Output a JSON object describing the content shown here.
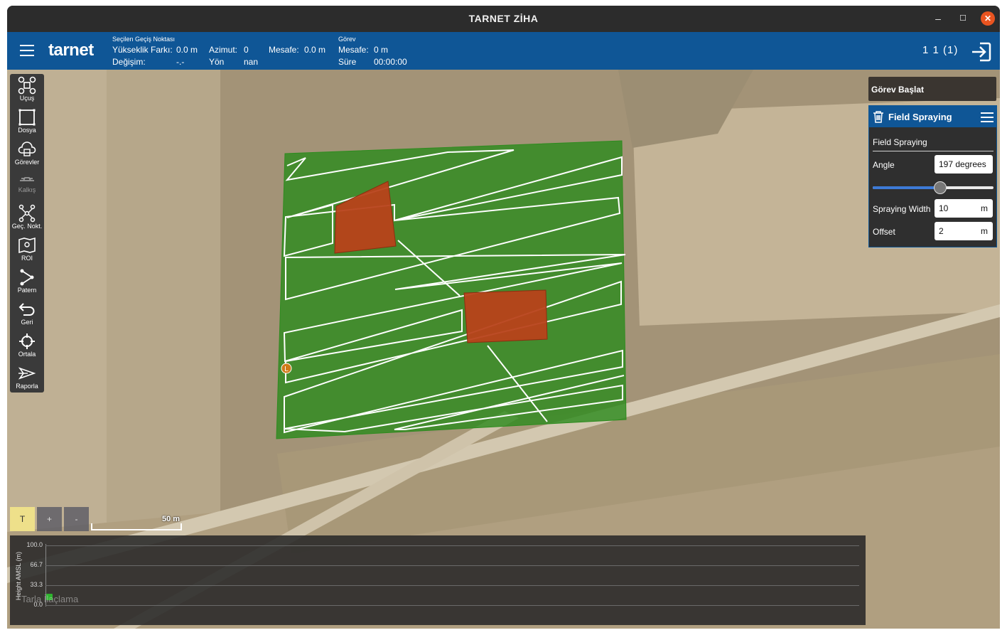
{
  "window": {
    "title": "TARNET ZİHA",
    "minimize": "–",
    "maximize": "☐",
    "close": "✕"
  },
  "topbar": {
    "logo": "tarnet",
    "selected_wp_heading": "Seçilen Geçiş Noktası",
    "alt_diff_label": "Yükseklik Farkı:",
    "alt_diff_value": "0.0 m",
    "azimuth_label": "Azimut:",
    "azimuth_value": "0",
    "distance_label": "Mesafe:",
    "distance_value": "0.0 m",
    "change_label": "Değişim:",
    "change_value": "-.-",
    "heading_label": "Yön",
    "heading_value": "nan",
    "mission_heading": "Görev",
    "mission_distance_label": "Mesafe:",
    "mission_distance_value": "0 m",
    "mission_time_label": "Süre",
    "mission_time_value": "00:00:00",
    "vehicle_status": "1 1 (1)"
  },
  "toolbar": [
    {
      "name": "flight",
      "label": "Uçuş",
      "icon": "drone-icon"
    },
    {
      "name": "file",
      "label": "Dosya",
      "icon": "file-icon"
    },
    {
      "name": "tasks",
      "label": "Görevler",
      "icon": "tasks-icon"
    },
    {
      "name": "takeoff",
      "label": "Kalkış",
      "icon": "takeoff-icon",
      "disabled": true
    },
    {
      "name": "waypoint",
      "label": "Geç. Nokt.",
      "icon": "waypoint-icon"
    },
    {
      "name": "roi",
      "label": "ROI",
      "icon": "roi-icon"
    },
    {
      "name": "pattern",
      "label": "Patern",
      "icon": "pattern-icon"
    },
    {
      "name": "return",
      "label": "Geri",
      "icon": "return-icon"
    },
    {
      "name": "center",
      "label": "Ortala",
      "icon": "center-icon"
    },
    {
      "name": "report",
      "label": "Raporla",
      "icon": "report-icon"
    }
  ],
  "mission_panel": {
    "start_button": "Görev Başlat",
    "title": "Field Spraying",
    "subtitle": "Field Spraying",
    "angle_label": "Angle",
    "angle_value": "197 degrees",
    "angle_slider_fraction": 0.55,
    "width_label": "Spraying Width",
    "width_value": "10",
    "width_unit": "m",
    "offset_label": "Offset",
    "offset_value": "2",
    "offset_unit": "m"
  },
  "map": {
    "zoom_t": "T",
    "zoom_in": "+",
    "zoom_out": "-",
    "scale_label": "50 m",
    "launch_marker": "L",
    "field_color": "#2e8b1f",
    "obstacle_color": "#b8421a"
  },
  "profile": {
    "y_axis_label": "Height AMSL (m)",
    "ticks": [
      "100.0",
      "66.7",
      "33.3",
      "0.0"
    ],
    "overlay_text": "Tarla İlaçlama"
  }
}
